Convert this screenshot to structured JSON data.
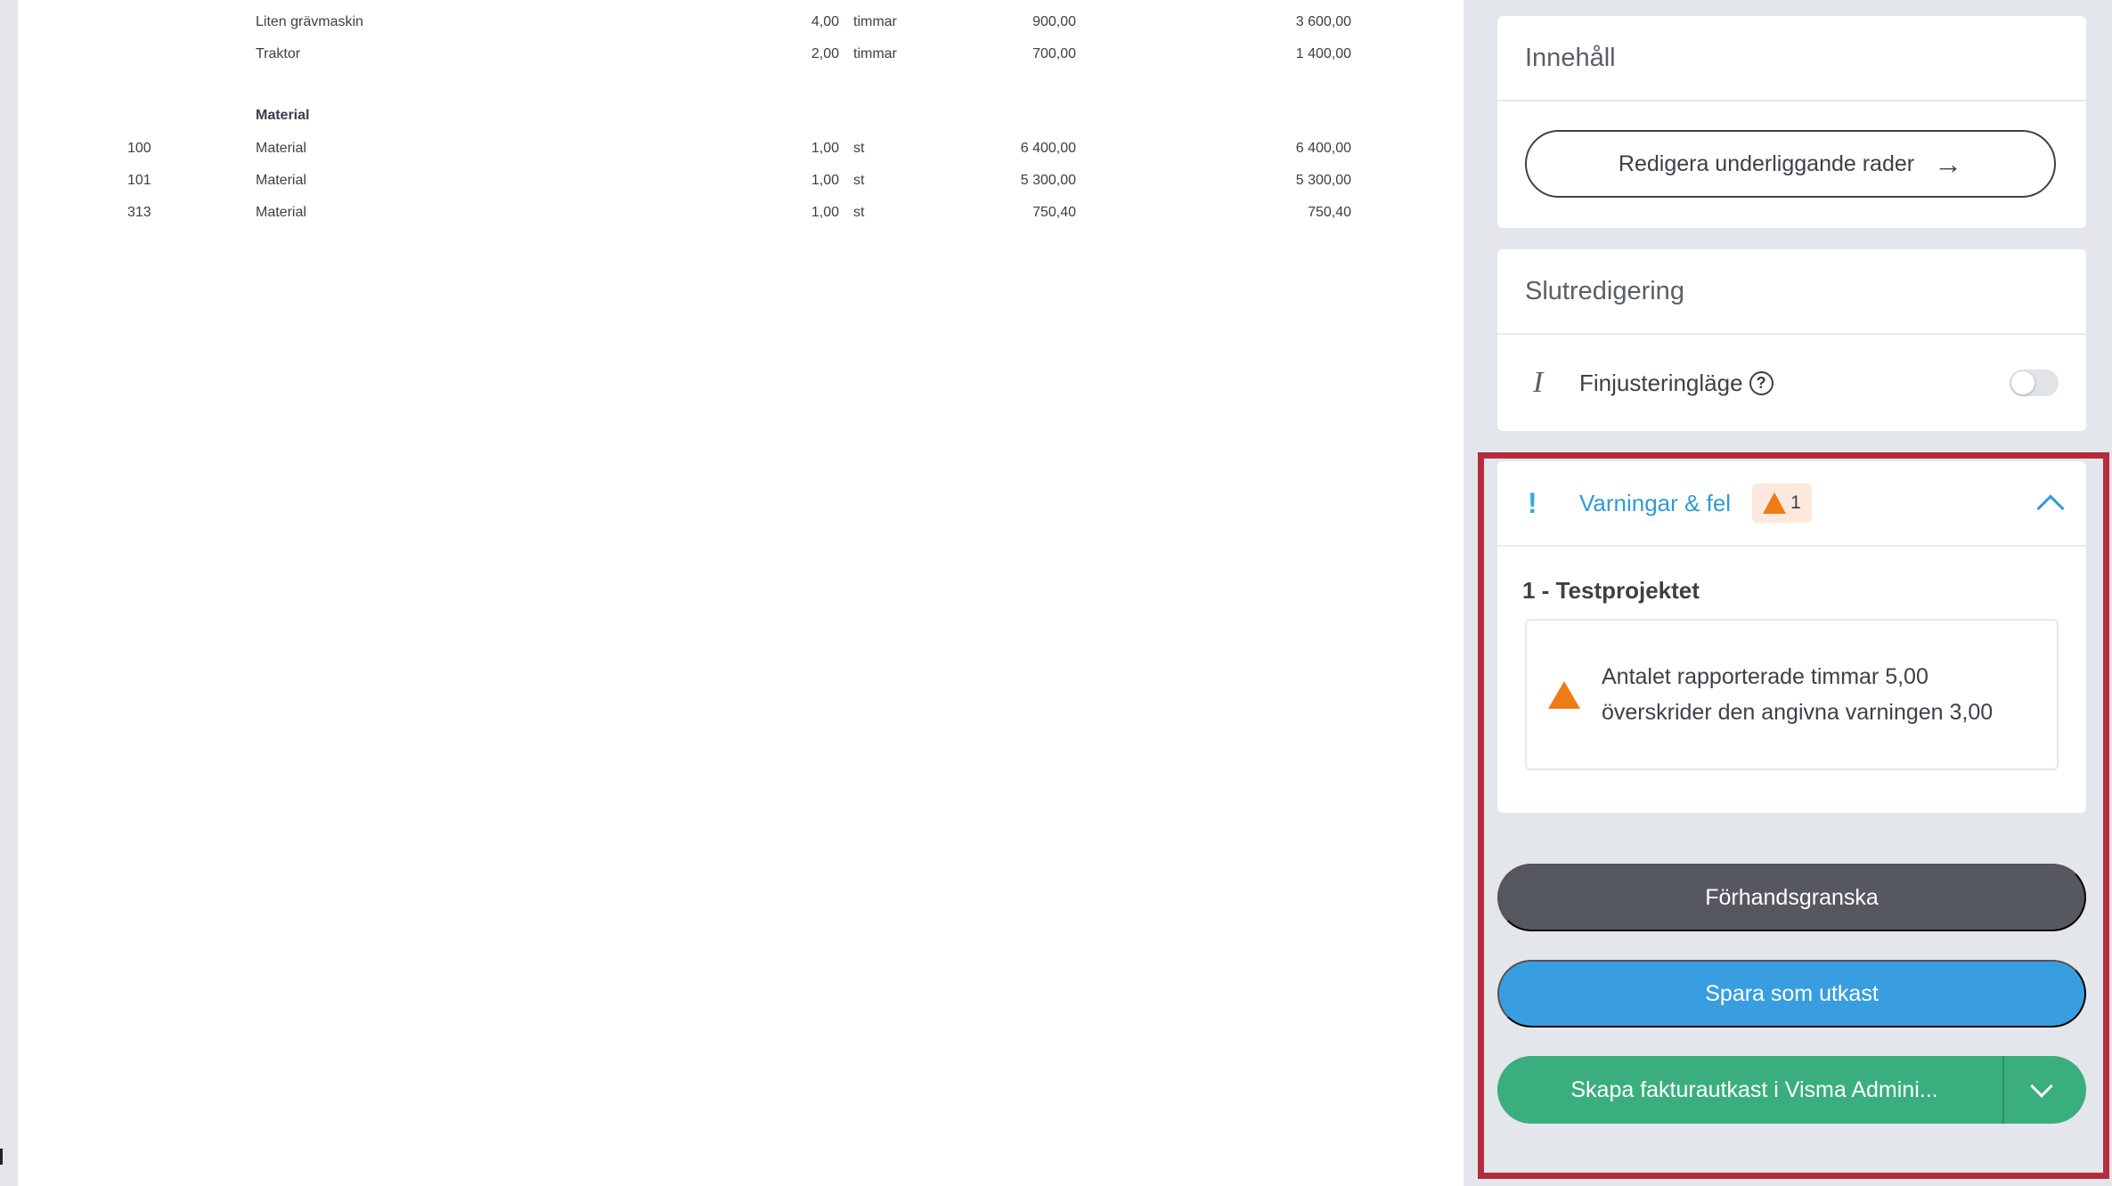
{
  "document": {
    "lines": [
      {
        "code": "",
        "name": "Liten grävmaskin",
        "qty": "4,00",
        "unit": "timmar",
        "price": "900,00",
        "total": "3 600,00"
      },
      {
        "code": "",
        "name": "Traktor",
        "qty": "2,00",
        "unit": "timmar",
        "price": "700,00",
        "total": "1 400,00"
      }
    ],
    "material_heading": "Material",
    "material_lines": [
      {
        "code": "100",
        "name": "Material",
        "qty": "1,00",
        "unit": "st",
        "price": "6 400,00",
        "total": "6 400,00"
      },
      {
        "code": "101",
        "name": "Material",
        "qty": "1,00",
        "unit": "st",
        "price": "5 300,00",
        "total": "5 300,00"
      },
      {
        "code": "313",
        "name": "Material",
        "qty": "1,00",
        "unit": "st",
        "price": "750,40",
        "total": "750,40"
      }
    ]
  },
  "sidebar": {
    "content": {
      "title": "Innehåll",
      "edit_button": "Redigera underliggande rader"
    },
    "final_edit": {
      "title": "Slutredigering",
      "toggle_label": "Finjusteringläge",
      "help_glyph": "?"
    },
    "warnings": {
      "exclamation": "!",
      "title": "Varningar & fel",
      "count": "1",
      "project": "1 - Testprojektet",
      "message": "Antalet rapporterade timmar 5,00 överskrider den angivna varningen 3,00"
    },
    "actions": {
      "preview": "Förhandsgranska",
      "save": "Spara som utkast",
      "create": "Skapa fakturautkast i Visma Admini..."
    }
  },
  "colors": {
    "primary_blue": "#389ee0",
    "success_green": "#3aae7e",
    "warning_orange": "#ef7b14",
    "highlight_red": "#b62b3f",
    "dark_gray": "#55595f"
  },
  "icons": [
    "arrow-right-icon",
    "italic-icon",
    "help-icon",
    "exclamation-icon",
    "warning-triangle-icon",
    "chevron-up-icon",
    "chevron-down-icon"
  ]
}
